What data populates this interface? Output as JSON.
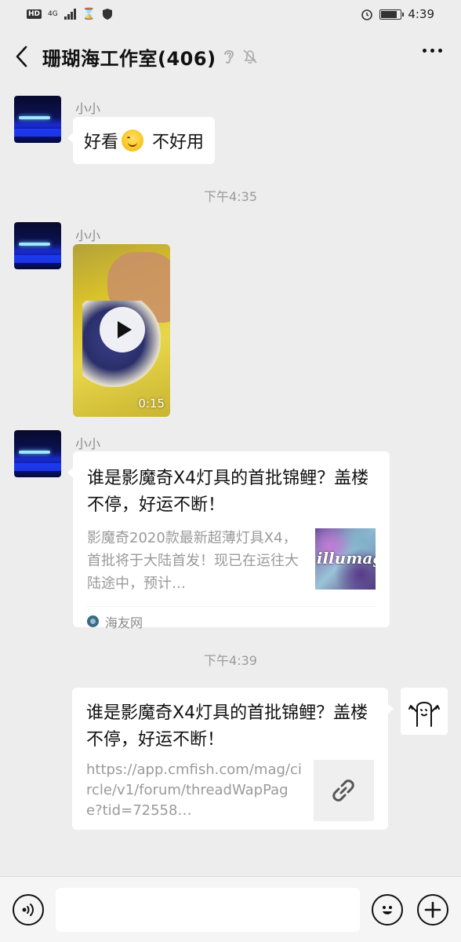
{
  "status_bar": {
    "left": {
      "hd": "HD",
      "network": "4G"
    },
    "time": "4:39"
  },
  "nav": {
    "title": "珊瑚海工作室(406)",
    "icons": [
      "back-icon",
      "ear-icon",
      "mute-bell-icon",
      "more-icon"
    ]
  },
  "messages": [
    {
      "type": "text",
      "sender": "小小",
      "text_before": "好看",
      "emoji": "smile-emoji",
      "text_after": " 不好用"
    },
    {
      "type": "time",
      "label": "下午4:35"
    },
    {
      "type": "video",
      "sender": "小小",
      "duration": "0:15"
    },
    {
      "type": "card",
      "sender": "小小",
      "title": "谁是影魔奇X4灯具的首批锦鲤？盖楼不停，好运不断！",
      "description": "影魔奇2020款最新超薄灯具X4，首批将于大陆首发！现已在运往大陆途中，预计…",
      "thumb_text": "illumag",
      "source": "海友网"
    },
    {
      "type": "time",
      "label": "下午4:39"
    },
    {
      "type": "link",
      "sender": "self",
      "title": "谁是影魔奇X4灯具的首批锦鲤？盖楼不停，好运不断！",
      "url": "https://app.cmfish.com/mag/circle/v1/forum/threadWapPage?tid=72558…"
    }
  ],
  "input_bar": {
    "icons": [
      "voice-icon",
      "emoji-icon",
      "plus-icon"
    ],
    "placeholder": ""
  }
}
